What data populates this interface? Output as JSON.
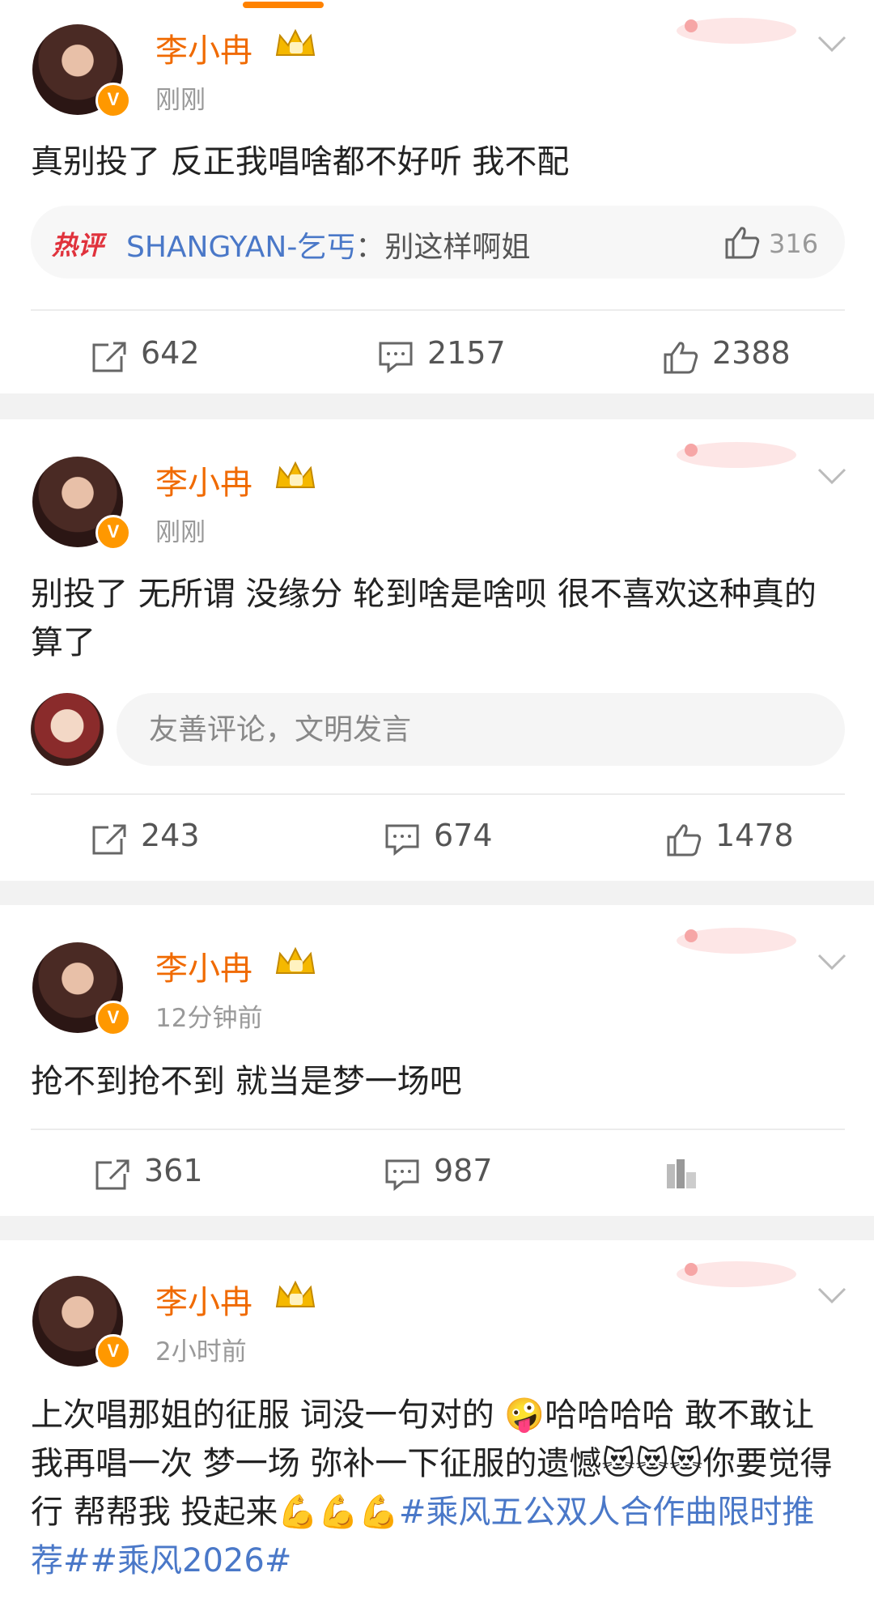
{
  "colors": {
    "accent": "#ff8200",
    "name": "#f06a00",
    "link": "#4a78c8",
    "hot_label": "#e0323c"
  },
  "posts": [
    {
      "username": "李小冉",
      "time": "刚刚",
      "text": "真别投了 反正我唱啥都不好听 我不配",
      "hot_comment": {
        "label": "热评",
        "user": "SHANGYAN-乞丐",
        "text": "：别这样啊姐",
        "likes": "316"
      },
      "reposts": "642",
      "comments": "2157",
      "likes": "2388"
    },
    {
      "username": "李小冉",
      "time": "刚刚",
      "text": "别投了 无所谓 没缘分 轮到啥是啥呗 很不喜欢这种真的 算了",
      "comment_input": {
        "placeholder": "友善评论，文明发言"
      },
      "reposts": "243",
      "comments": "674",
      "likes": "1478"
    },
    {
      "username": "李小冉",
      "time": "12分钟前",
      "text": "抢不到抢不到 就当是梦一场吧",
      "reposts": "361",
      "comments": "987"
    },
    {
      "username": "李小冉",
      "time": "2小时前",
      "text_parts": {
        "a": "上次唱那姐的征服 词没一句对的 🤪哈哈哈哈 敢不敢让我再唱一次 梦一场 弥补一下征服的遗憾😻😻😻你要觉得行 帮帮我 投起来💪💪💪",
        "tag1": "#乘风五公双人合作曲限时推荐#",
        "tag2": "#乘风2026#"
      }
    }
  ],
  "icons": {
    "repost": "repost-icon",
    "comment": "comment-icon",
    "like": "thumbs-up-icon",
    "more": "chevron-down-icon",
    "verified": "verified-badge-icon",
    "vip": "crown-icon"
  }
}
